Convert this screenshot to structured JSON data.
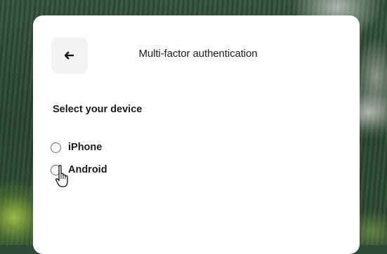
{
  "dialog": {
    "title": "Multi-factor authentication",
    "subtitle": "Select your device",
    "back_icon": "arrow-left-icon",
    "options": [
      {
        "label": "iPhone",
        "selected": false
      },
      {
        "label": "Android",
        "selected": false
      }
    ]
  },
  "cursor": {
    "type": "pointer-hand",
    "hovering": "Android"
  }
}
